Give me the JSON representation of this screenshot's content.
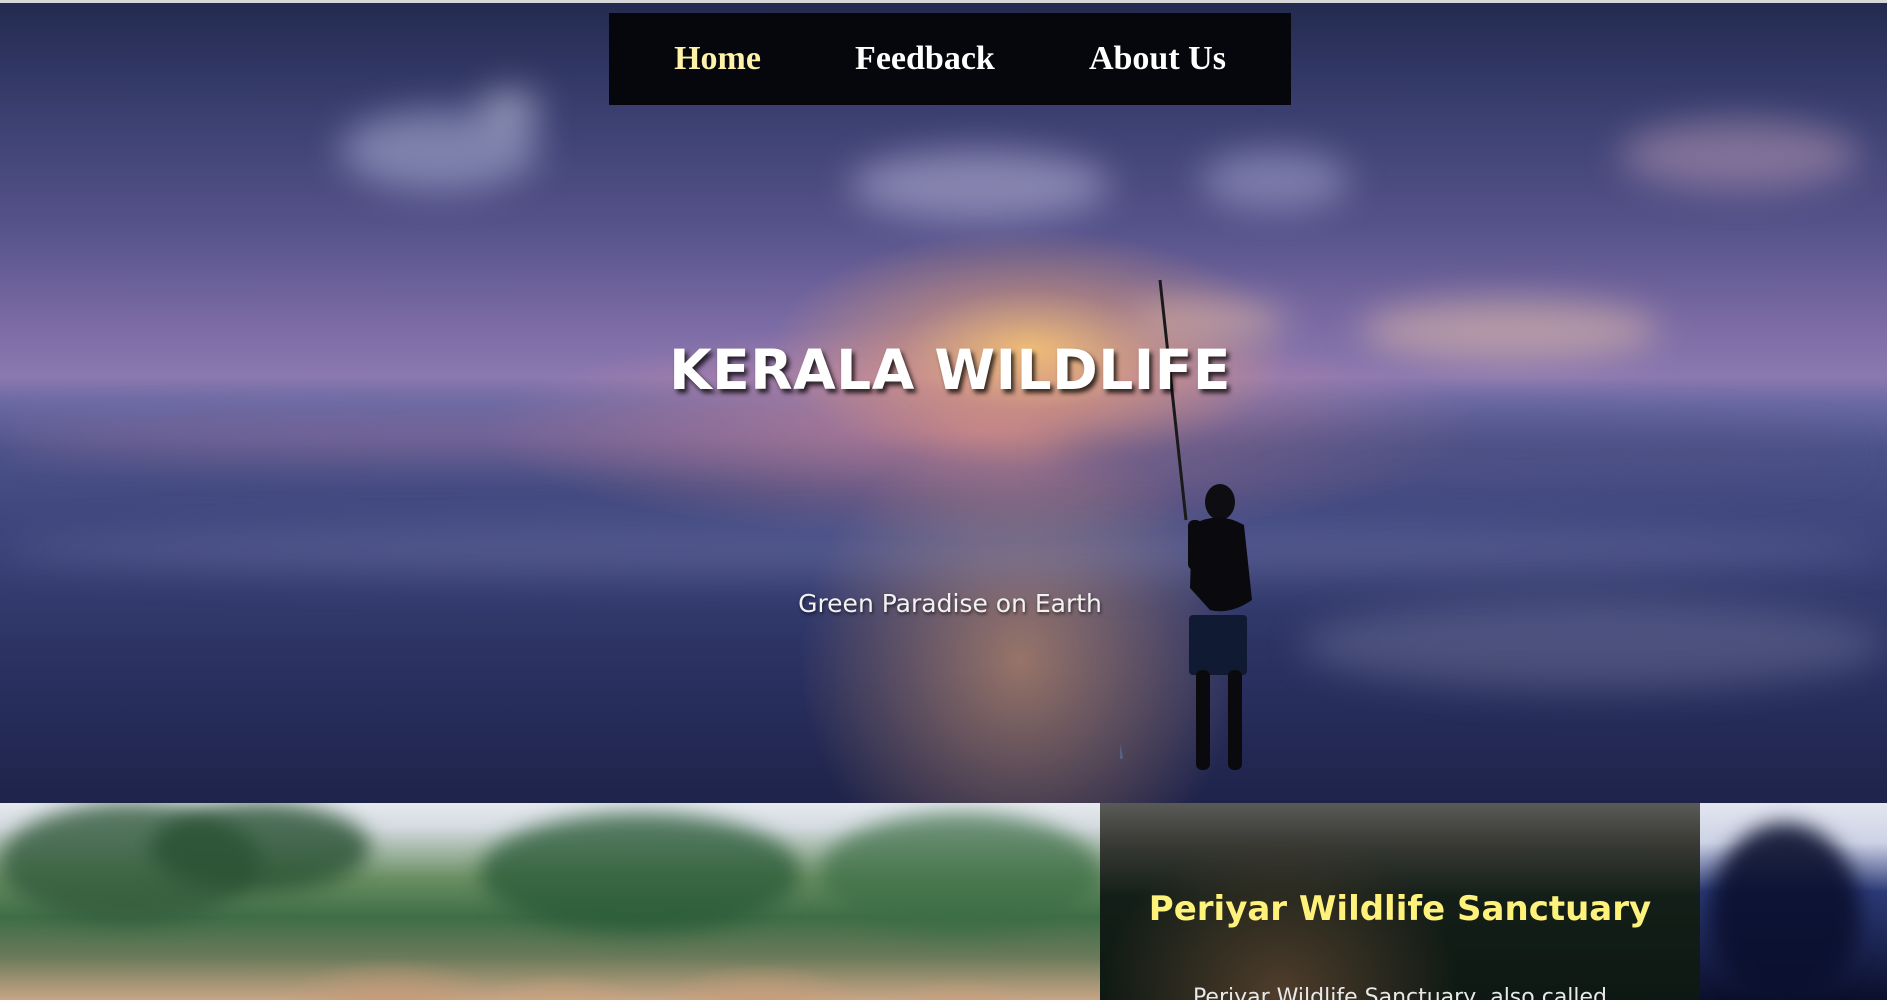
{
  "nav": {
    "items": [
      {
        "label": "Home",
        "active": true
      },
      {
        "label": "Feedback",
        "active": false
      },
      {
        "label": "About Us",
        "active": false
      }
    ]
  },
  "hero": {
    "title": "KERALA WILDLIFE",
    "subtitle": "Green Paradise on Earth"
  },
  "featured": {
    "title": "Periyar Wildlife Sanctuary",
    "text": "Periyar Wildlife Sanctuary, also called"
  },
  "colors": {
    "nav_bg": "#05070d",
    "nav_active": "#fff1a8",
    "card_title": "#fff27a"
  }
}
